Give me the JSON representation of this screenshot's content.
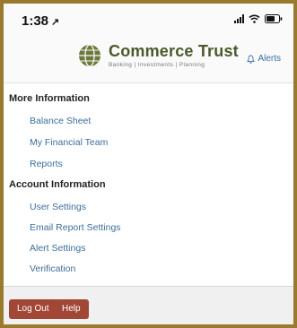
{
  "status_bar": {
    "time": "1:38",
    "location_arrow": "↗",
    "icons": [
      "signal-icon",
      "wifi-icon",
      "battery-icon"
    ]
  },
  "header": {
    "brand_name": "Commerce Trust",
    "brand_tagline": "Banking | Investments | Planning",
    "alerts_label": "Alerts",
    "colors": {
      "brand": "#4a5a2a",
      "link": "#3a6fa5"
    }
  },
  "menu": {
    "sections": [
      {
        "title": "More Information",
        "items": [
          "Balance Sheet",
          "My Financial Team",
          "Reports"
        ]
      },
      {
        "title": "Account Information",
        "items": [
          "User Settings",
          "Email Report Settings",
          "Alert Settings",
          "Verification"
        ]
      }
    ]
  },
  "footer": {
    "logout_label": "Log Out",
    "help_label": "Help",
    "button_color": "#a24735"
  }
}
